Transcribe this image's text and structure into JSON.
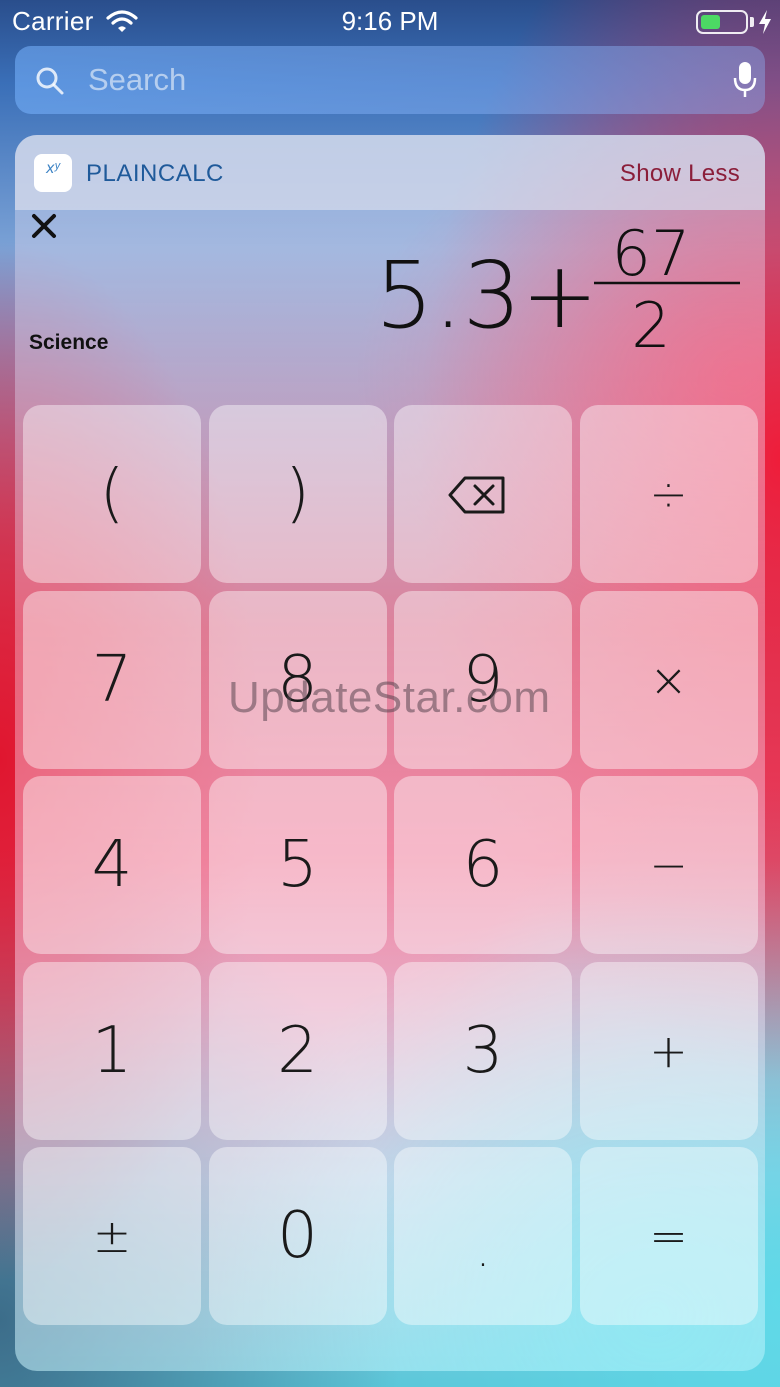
{
  "status_bar": {
    "carrier": "Carrier",
    "time": "9:16 PM",
    "battery_level": 0.45
  },
  "search": {
    "placeholder": "Search"
  },
  "widget": {
    "app_name": "PLAINCALC",
    "toggle_label": "Show Less",
    "mode_label": "Science",
    "expression": {
      "lead": "5.3+",
      "numerator": "67",
      "denominator": "2"
    },
    "keys": [
      [
        "(",
        ")",
        "backspace",
        "÷"
      ],
      [
        "7",
        "8",
        "9",
        "×"
      ],
      [
        "4",
        "5",
        "6",
        "−"
      ],
      [
        "1",
        "2",
        "3",
        "+"
      ],
      [
        "±",
        "0",
        ".",
        "="
      ]
    ],
    "icon_text": "xʸ"
  },
  "watermark": "UpdateStar.com",
  "colors": {
    "battery": "#4cd964",
    "app_name": "#1f5a9a",
    "show_less": "#8b1e3a"
  },
  "icons": [
    "wifi-icon",
    "battery-icon",
    "bolt-icon",
    "search-icon",
    "microphone-icon",
    "close-icon",
    "backspace-icon"
  ]
}
